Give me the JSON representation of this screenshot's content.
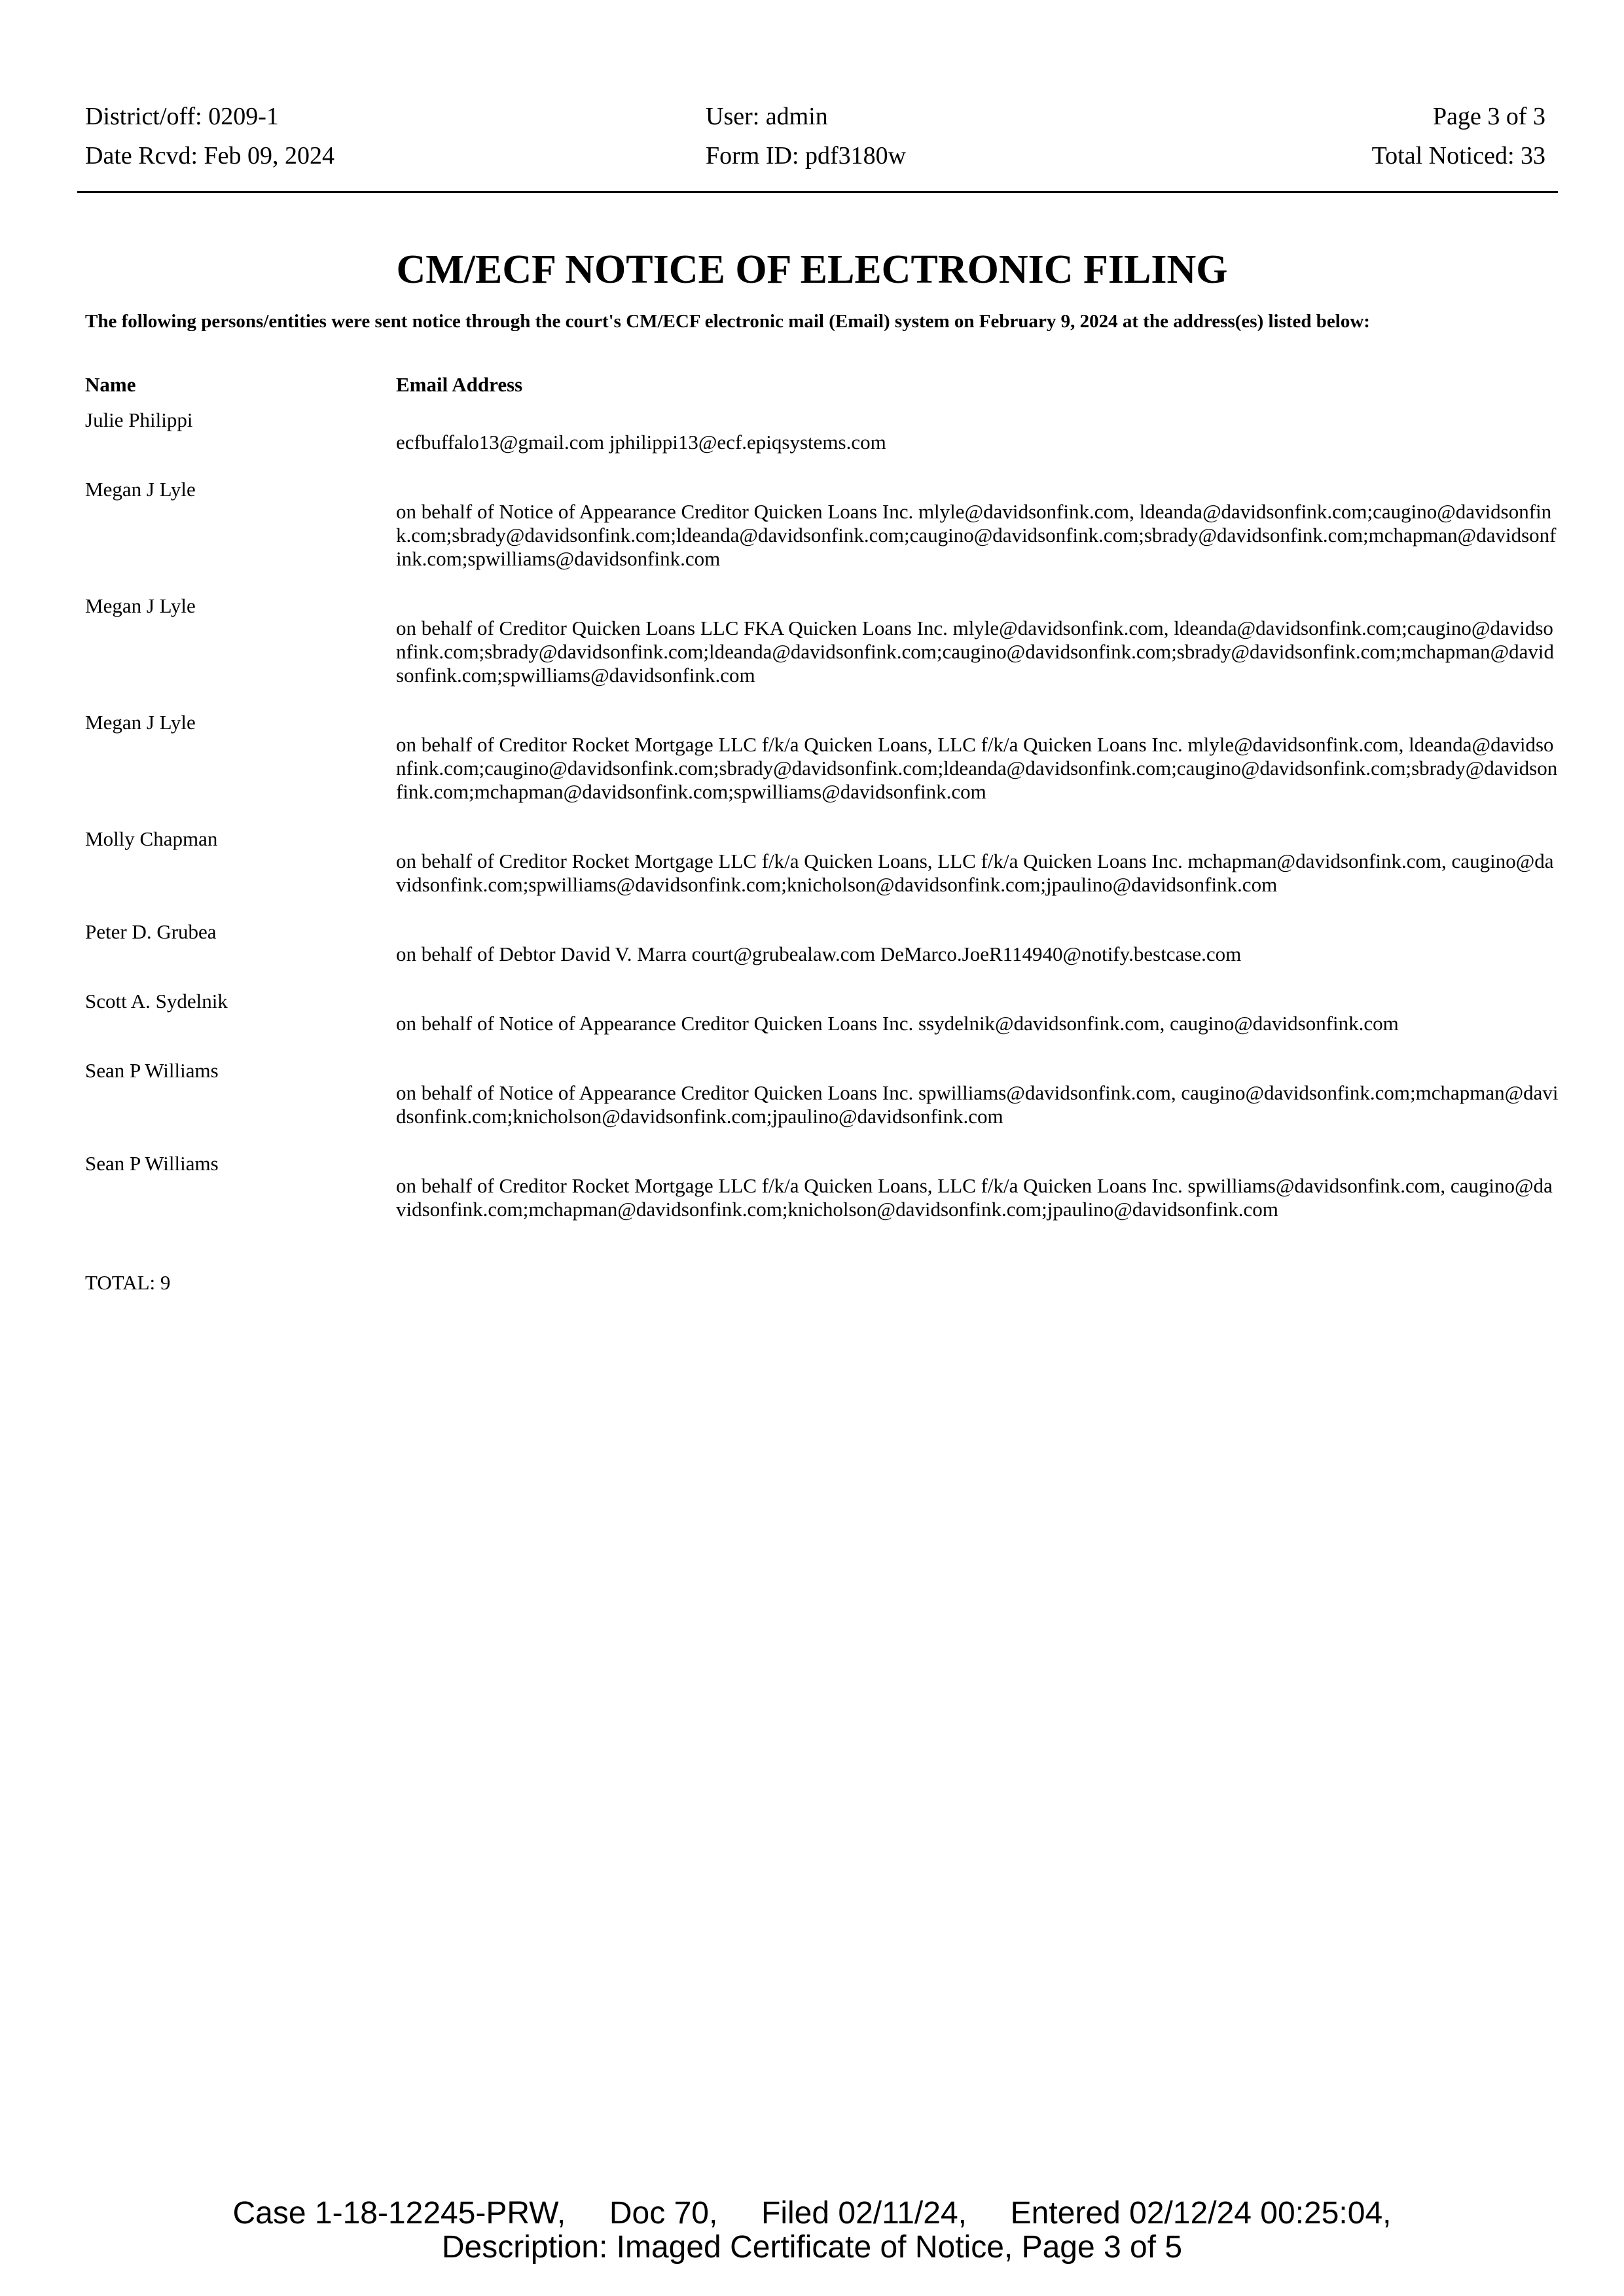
{
  "header": {
    "district": "District/off: 0209-1",
    "date_rcvd": "Date Rcvd: Feb 09, 2024",
    "user": "User: admin",
    "form_id": "Form ID: pdf3180w",
    "page": "Page 3 of 3",
    "total_noticed": "Total Noticed: 33"
  },
  "title": "CM/ECF NOTICE OF ELECTRONIC FILING",
  "intro": "The following persons/entities were sent notice through the court's CM/ECF electronic mail (Email) system on February 9, 2024 at the address(es) listed below:",
  "columns": {
    "name": "Name",
    "email": "Email Address"
  },
  "entries": [
    {
      "name": "Julie Philippi",
      "email": "ecfbuffalo13@gmail.com  jphilippi13@ecf.epiqsystems.com"
    },
    {
      "name": "Megan J Lyle",
      "email": "on behalf of Notice of Appearance Creditor Quicken Loans  Inc. mlyle@davidsonfink.com, ldeanda@davidsonfink.com;caugino@davidsonfink.com;sbrady@davidsonfink.com;ldeanda@davidsonfink.com;caugino@davidsonfink.com;sbrady@davidsonfink.com;mchapman@davidsonfink.com;spwilliams@davidsonfink.com"
    },
    {
      "name": "Megan J Lyle",
      "email": "on behalf of Creditor Quicken Loans  LLC FKA Quicken Loans Inc. mlyle@davidsonfink.com, ldeanda@davidsonfink.com;caugino@davidsonfink.com;sbrady@davidsonfink.com;ldeanda@davidsonfink.com;caugino@davidsonfink.com;sbrady@davidsonfink.com;mchapman@davidsonfink.com;spwilliams@davidsonfink.com"
    },
    {
      "name": "Megan J Lyle",
      "email": "on behalf of Creditor Rocket Mortgage  LLC f/k/a Quicken Loans, LLC f/k/a Quicken Loans Inc. mlyle@davidsonfink.com, ldeanda@davidsonfink.com;caugino@davidsonfink.com;sbrady@davidsonfink.com;ldeanda@davidsonfink.com;caugino@davidsonfink.com;sbrady@davidsonfink.com;mchapman@davidsonfink.com;spwilliams@davidsonfink.com"
    },
    {
      "name": "Molly Chapman",
      "email": "on behalf of Creditor Rocket Mortgage  LLC f/k/a Quicken Loans, LLC f/k/a Quicken Loans Inc. mchapman@davidsonfink.com, caugino@davidsonfink.com;spwilliams@davidsonfink.com;knicholson@davidsonfink.com;jpaulino@davidsonfink.com"
    },
    {
      "name": "Peter D. Grubea",
      "email": "on behalf of Debtor David V. Marra court@grubealaw.com  DeMarco.JoeR114940@notify.bestcase.com"
    },
    {
      "name": "Scott A. Sydelnik",
      "email": "on behalf of Notice of Appearance Creditor Quicken Loans  Inc. ssydelnik@davidsonfink.com, caugino@davidsonfink.com"
    },
    {
      "name": "Sean P Williams",
      "email": "on behalf of Notice of Appearance Creditor Quicken Loans  Inc. spwilliams@davidsonfink.com, caugino@davidsonfink.com;mchapman@davidsonfink.com;knicholson@davidsonfink.com;jpaulino@davidsonfink.com"
    },
    {
      "name": "Sean P Williams",
      "email": "on behalf of Creditor Rocket Mortgage  LLC f/k/a Quicken Loans, LLC f/k/a Quicken Loans Inc. spwilliams@davidsonfink.com, caugino@davidsonfink.com;mchapman@davidsonfink.com;knicholson@davidsonfink.com;jpaulino@davidsonfink.com"
    }
  ],
  "total": "TOTAL: 9",
  "footer": {
    "line1": "Case 1-18-12245-PRW,     Doc 70,     Filed 02/11/24,     Entered 02/12/24 00:25:04,",
    "line2": "Description: Imaged Certificate of Notice, Page 3 of 5"
  }
}
